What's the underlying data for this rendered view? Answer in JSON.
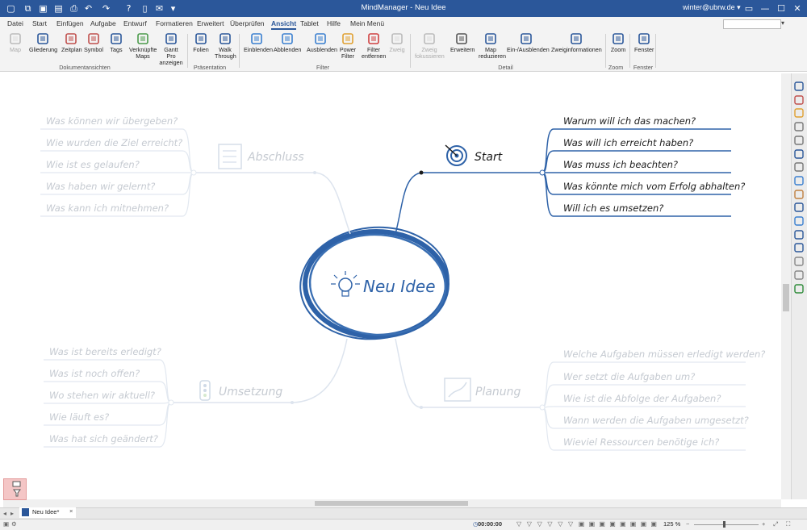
{
  "titlebar": {
    "title": "MindManager - Neu Idee",
    "user": "winter@ubrw.de ▾",
    "quick_access_icons": [
      "new-icon",
      "new-map-icon",
      "open-icon",
      "save-icon",
      "print-icon",
      "undo-icon",
      "redo-icon",
      "help-icon",
      "document-icon",
      "mail-icon",
      "dropdown-icon"
    ],
    "window_controls": [
      "restore-ribbon-icon",
      "minimize-icon",
      "maximize-icon",
      "close-icon"
    ]
  },
  "tabs": [
    "Datei",
    "Start",
    "Einfügen",
    "Aufgabe",
    "Entwurf",
    "Formatieren",
    "Erweitert",
    "Überprüfen",
    "Ansicht",
    "Tablet",
    "Hilfe",
    "Mein Menü"
  ],
  "active_tab": "Ansicht",
  "ribbon": {
    "buttons": [
      {
        "label": "Map",
        "disabled": true
      },
      {
        "label": "Gliederung"
      },
      {
        "label": "Zeitplan"
      },
      {
        "label": "Symbol"
      },
      {
        "label": "Tags"
      },
      {
        "label": "Verknüpfte Maps"
      },
      {
        "label": "Gantt Pro anzeigen"
      },
      {
        "label": "Folien"
      },
      {
        "label": "Walk Through"
      },
      {
        "label": "Einblenden"
      },
      {
        "label": "Abblenden"
      },
      {
        "label": "Ausblenden"
      },
      {
        "label": "Power Filter"
      },
      {
        "label": "Filter entfernen"
      },
      {
        "label": "Zweig",
        "disabled": true
      },
      {
        "label": "Zweig fokussieren",
        "disabled": true
      },
      {
        "label": "Erweitern"
      },
      {
        "label": "Map reduzieren"
      },
      {
        "label": "Ein-/Ausblenden"
      },
      {
        "label": "Zweiginformationen"
      },
      {
        "label": "Zoom"
      },
      {
        "label": "Fenster"
      }
    ],
    "groups": [
      "Dokumentansichten",
      "Präsentation",
      "Filter",
      "Detail",
      "Zoom",
      "Fenster"
    ]
  },
  "map": {
    "central": "Neu Idee",
    "branches": [
      {
        "name": "Start",
        "dimmed": false,
        "children": [
          "Warum will ich das machen?",
          "Was will ich erreicht haben?",
          "Was muss ich beachten?",
          "Was könnte mich vom Erfolg abhalten?",
          "Will ich es umsetzen?"
        ]
      },
      {
        "name": "Abschluss",
        "dimmed": true,
        "children": [
          "Was können wir übergeben?",
          "Wie wurden die Ziel erreicht?",
          "Wie ist es gelaufen?",
          "Was haben wir gelernt?",
          "Was kann ich mitnehmen?"
        ]
      },
      {
        "name": "Umsetzung",
        "dimmed": true,
        "children": [
          "Was ist bereits erledigt?",
          "Was ist noch offen?",
          "Wo stehen wir aktuell?",
          "Wie läuft es?",
          "Was hat sich geändert?"
        ]
      },
      {
        "name": "Planung",
        "dimmed": true,
        "children": [
          "Welche Aufgaben müssen erledigt werden?",
          "Wer setzt die Aufgaben um?",
          "Wie ist die Abfolge der Aufgaben?",
          "Wann werden die Aufgaben umgesetzt?",
          "Wieviel Ressourcen benötige ich?"
        ]
      }
    ]
  },
  "doctab": {
    "label": "Neu Idee*"
  },
  "status": {
    "time": "00:00:00",
    "zoom": "125 %"
  },
  "colors": {
    "accent": "#2b579a",
    "map_blue": "#2e62a8",
    "dim": "#c8d4e3",
    "dim_text": "#b9bec6"
  }
}
